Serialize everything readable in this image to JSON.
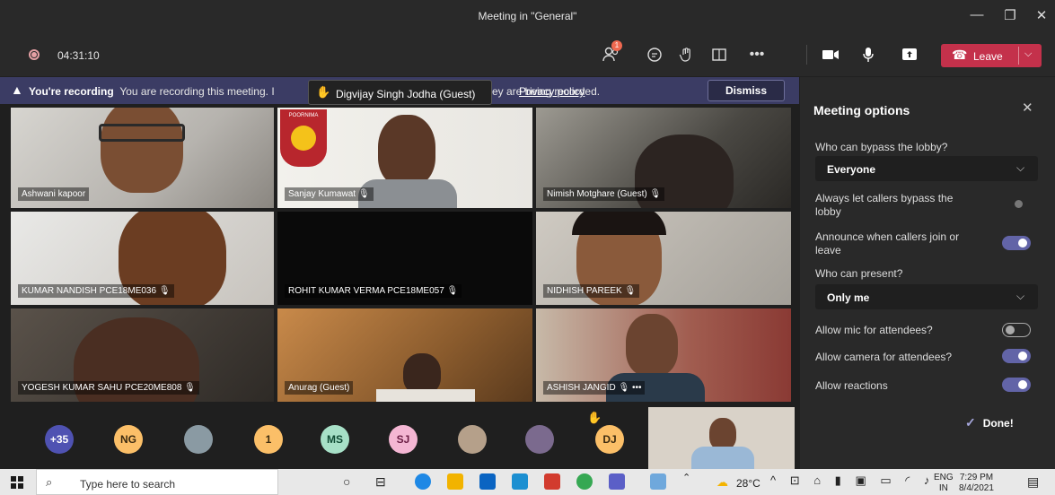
{
  "window": {
    "title": "Meeting in \"General\"",
    "min": "—",
    "max": "❐",
    "close": "✕"
  },
  "toolbar": {
    "timer": "04:31:10",
    "participants_badge": "1",
    "leave_label": "Leave"
  },
  "banner": {
    "bold": "You're recording",
    "text": "You are recording this meeting. I",
    "tail": "ey are being recorded.",
    "privacy": "Privacy policy",
    "dismiss": "Dismiss"
  },
  "tooltip": {
    "name": "Digvijay Singh Jodha (Guest)"
  },
  "tiles": [
    {
      "name": "Ashwani kapoor"
    },
    {
      "name": "Sanjay Kumawat"
    },
    {
      "name": "Nimish Motghare (Guest)"
    },
    {
      "name": "KUMAR NANDISH PCE18ME036"
    },
    {
      "name": "ROHIT KUMAR VERMA PCE18ME057"
    },
    {
      "name": "NIDHISH PAREEK"
    },
    {
      "name": "YOGESH KUMAR SAHU PCE20ME808"
    },
    {
      "name": "Anurag (Guest)"
    },
    {
      "name": "ASHISH JANGID"
    }
  ],
  "poster_text": "POORNIMA",
  "roster": [
    {
      "initials": "+35",
      "color": "#4f52b2",
      "fg": "#ffffff"
    },
    {
      "initials": "NG",
      "color": "#fbbf68",
      "fg": "#3a2a10"
    },
    {
      "initials": "",
      "color": "#8a9aa3",
      "fg": "#ffffff"
    },
    {
      "initials": "1",
      "color": "#fbbf68",
      "fg": "#3a2a10"
    },
    {
      "initials": "MS",
      "color": "#a7e0c7",
      "fg": "#0f4a33"
    },
    {
      "initials": "SJ",
      "color": "#f4b6d3",
      "fg": "#6b1d44"
    },
    {
      "initials": "",
      "color": "#b5a08a",
      "fg": "#ffffff"
    },
    {
      "initials": "",
      "color": "#7b6a8e",
      "fg": "#ffffff"
    },
    {
      "initials": "DJ",
      "color": "#fbbf68",
      "fg": "#3a2a10"
    }
  ],
  "panel": {
    "title": "Meeting options",
    "bypass_label": "Who can bypass the lobby?",
    "bypass_value": "Everyone",
    "callers_label": "Always let callers bypass the lobby",
    "announce_label": "Announce when callers join or leave",
    "present_label": "Who can present?",
    "present_value": "Only me",
    "mic_label": "Allow mic for attendees?",
    "camera_label": "Allow camera for attendees?",
    "reactions_label": "Allow reactions",
    "done": "Done!"
  },
  "taskbar": {
    "search_placeholder": "Type here to search",
    "weather": "28°C",
    "lang1": "ENG",
    "lang2": "IN",
    "time": "7:29 PM",
    "date": "8/4/2021"
  }
}
